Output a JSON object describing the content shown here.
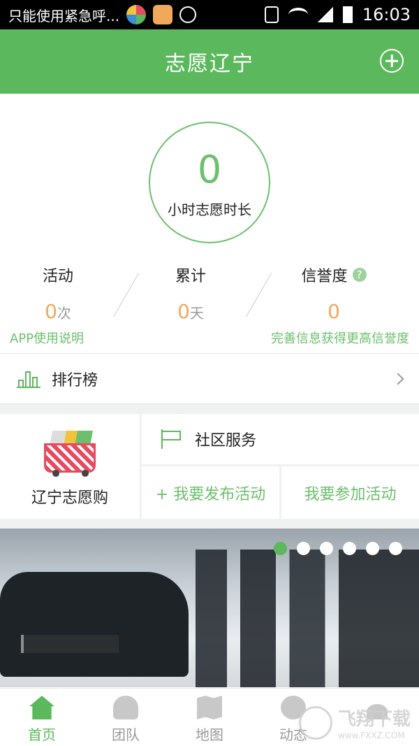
{
  "status_bar": {
    "notification_text": "只能使用紧急呼...",
    "time": "16:03"
  },
  "header": {
    "title": "志愿辽宁"
  },
  "summary": {
    "hours_value": "0",
    "hours_label": "小时志愿时长",
    "stats": [
      {
        "label": "活动",
        "value": "0",
        "unit": "次"
      },
      {
        "label": "累计",
        "value": "0",
        "unit": "天"
      },
      {
        "label": "信誉度",
        "value": "0",
        "unit": "",
        "help": "?"
      }
    ],
    "app_help_link": "APP使用说明",
    "credit_tip_link": "完善信息获得更高信誉度"
  },
  "ranking": {
    "label": "排行榜"
  },
  "shop": {
    "label": "辽宁志愿购"
  },
  "community": {
    "label": "社区服务",
    "publish_label": "+ 我要发布活动",
    "join_label": "我要参加活动"
  },
  "banner": {
    "active_index": 0,
    "total": 6
  },
  "tabs": [
    {
      "label": "首页",
      "icon": "home-icon",
      "active": true
    },
    {
      "label": "团队",
      "icon": "team-icon",
      "active": false
    },
    {
      "label": "地图",
      "icon": "map-icon",
      "active": false
    },
    {
      "label": "动态",
      "icon": "chat-icon",
      "active": false
    },
    {
      "label": "",
      "icon": "profile-icon",
      "active": false
    }
  ],
  "watermark": {
    "brand": "飞翔下载",
    "url": "www.FXXZ.COM"
  },
  "colors": {
    "primary": "#5cb85c",
    "accent_orange": "#f0a95a"
  }
}
